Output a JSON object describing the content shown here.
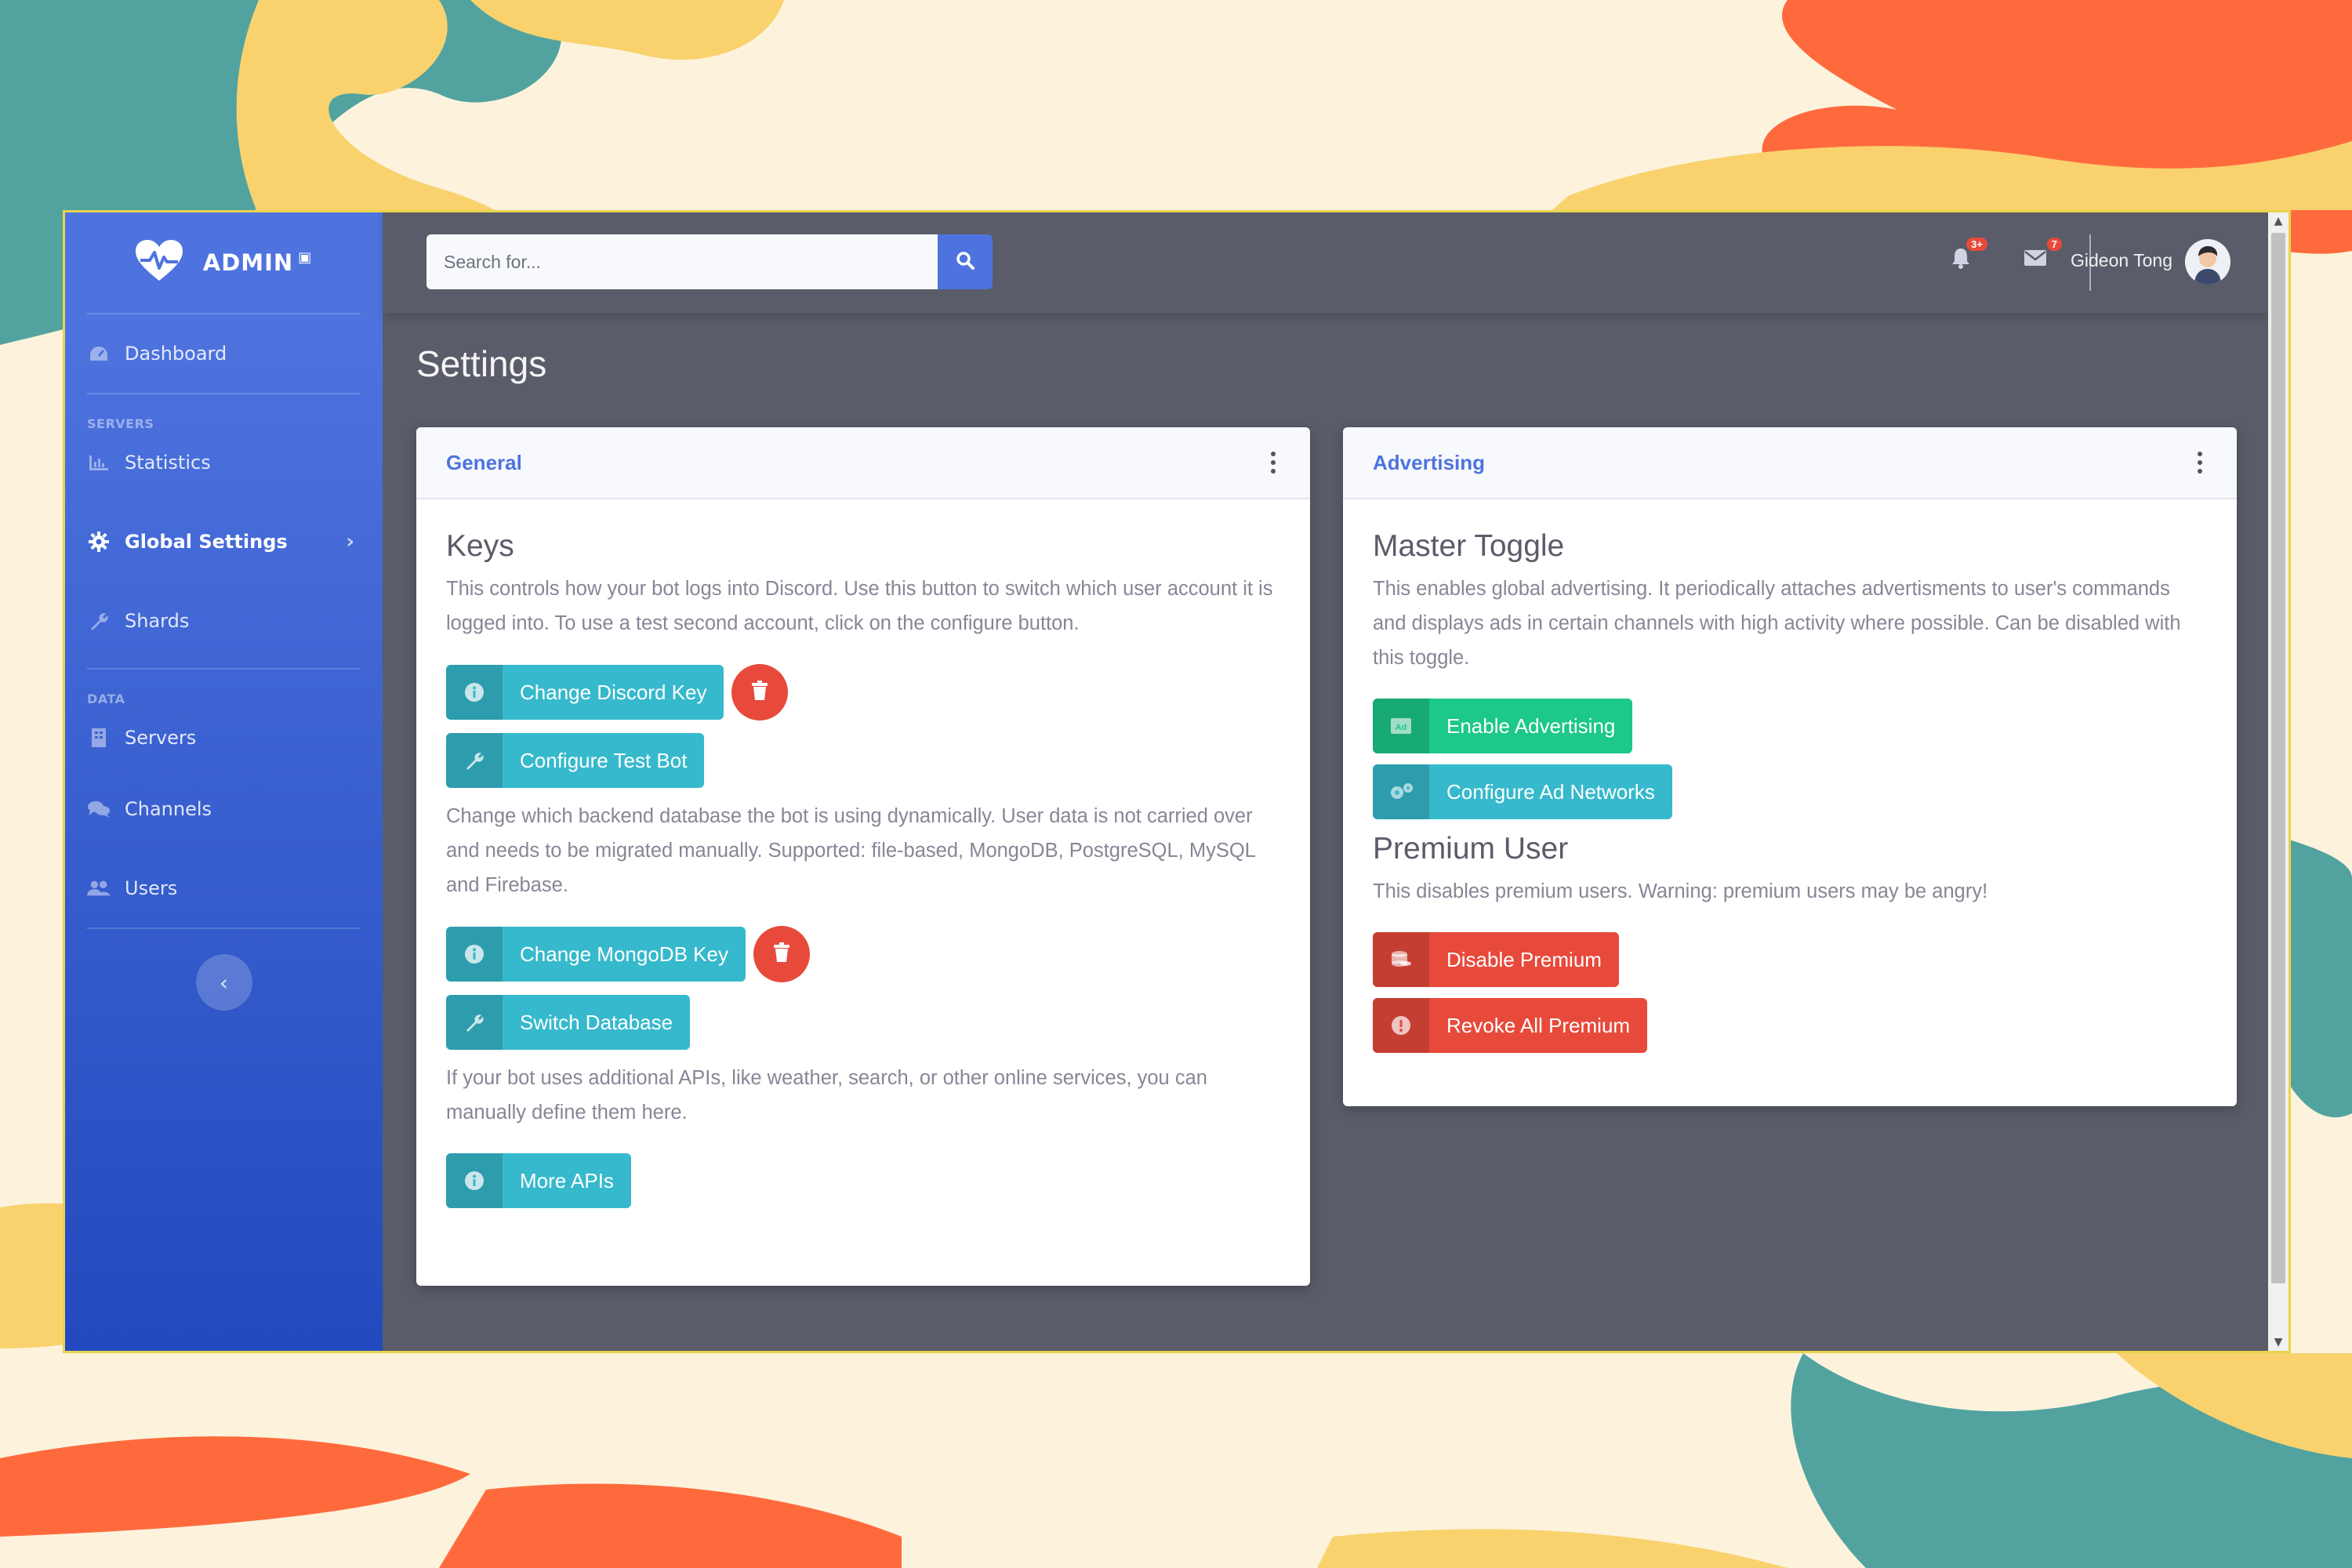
{
  "sidebar": {
    "brand": "ADMIN",
    "items": [
      {
        "label": "Dashboard",
        "icon": "tachometer-icon"
      },
      {
        "label": "Statistics",
        "icon": "chart-icon"
      },
      {
        "label": "Global Settings",
        "icon": "cog-icon",
        "active": true
      },
      {
        "label": "Shards",
        "icon": "wrench-icon"
      },
      {
        "label": "Servers",
        "icon": "server-icon"
      },
      {
        "label": "Channels",
        "icon": "comments-icon"
      },
      {
        "label": "Users",
        "icon": "users-icon"
      }
    ],
    "headings": [
      "Servers",
      "Data"
    ]
  },
  "topbar": {
    "search_placeholder": "Search for...",
    "alerts_badge": "3+",
    "messages_badge": "7",
    "user_name": "Gideon Tong"
  },
  "page": {
    "title": "Settings"
  },
  "general": {
    "title": "General",
    "keys_heading": "Keys",
    "keys_text": "This controls how your bot logs into Discord. Use this button to switch which user account it is logged into. To use a test second account, click on the configure button.",
    "change_discord_key": "Change Discord Key",
    "configure_test_bot": "Configure Test Bot",
    "db_text": "Change which backend database the bot is using dynamically. User data is not carried over and needs to be migrated manually. Supported: file-based, MongoDB, PostgreSQL, MySQL and Firebase.",
    "change_mongodb_key": "Change MongoDB Key",
    "switch_database": "Switch Database",
    "apis_text": "If your bot uses additional APIs, like weather, search, or other online services, you can manually define them here.",
    "more_apis": "More APIs"
  },
  "advertising": {
    "title": "Advertising",
    "master_heading": "Master Toggle",
    "master_text": "This enables global advertising. It periodically attaches advertisments to user's commands and displays ads in certain channels with high activity where possible. Can be disabled with this toggle.",
    "enable_advertising": "Enable Advertising",
    "configure_ad_networks": "Configure Ad Networks",
    "premium_heading": "Premium User",
    "premium_text": "This disables premium users. Warning: premium users may be angry!",
    "disable_premium": "Disable Premium",
    "revoke_all_premium": "Revoke All Premium"
  },
  "colors": {
    "primary": "#4e73df",
    "info": "#36b9cc",
    "success": "#1cc88a",
    "danger": "#e74a3b",
    "content_bg": "#5a5c69"
  }
}
